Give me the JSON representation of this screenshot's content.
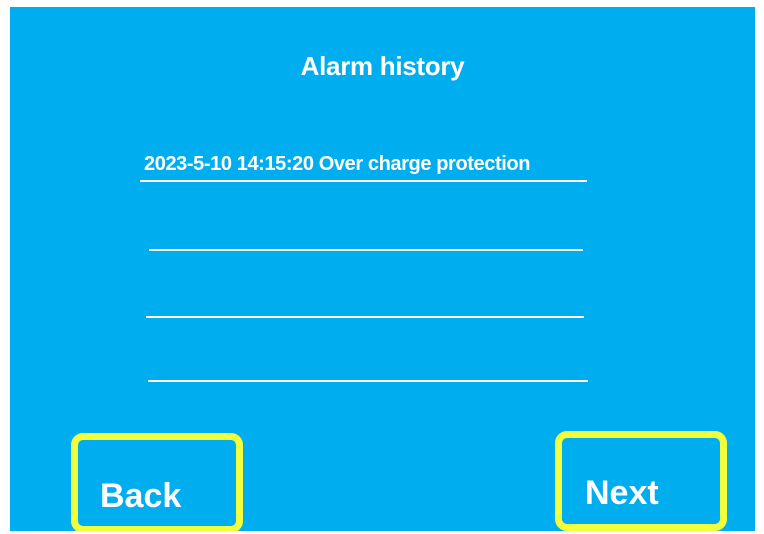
{
  "screen": {
    "title": "Alarm history"
  },
  "alarm_list": {
    "rows": [
      {
        "text": "2023-5-10 14:15:20 Over charge protection"
      },
      {
        "text": ""
      },
      {
        "text": ""
      },
      {
        "text": ""
      }
    ]
  },
  "buttons": {
    "back_label": "Back",
    "next_label": "Next"
  },
  "colors": {
    "background": "#00aeef",
    "text": "#ffffff",
    "button_border": "#f2ff3c"
  }
}
